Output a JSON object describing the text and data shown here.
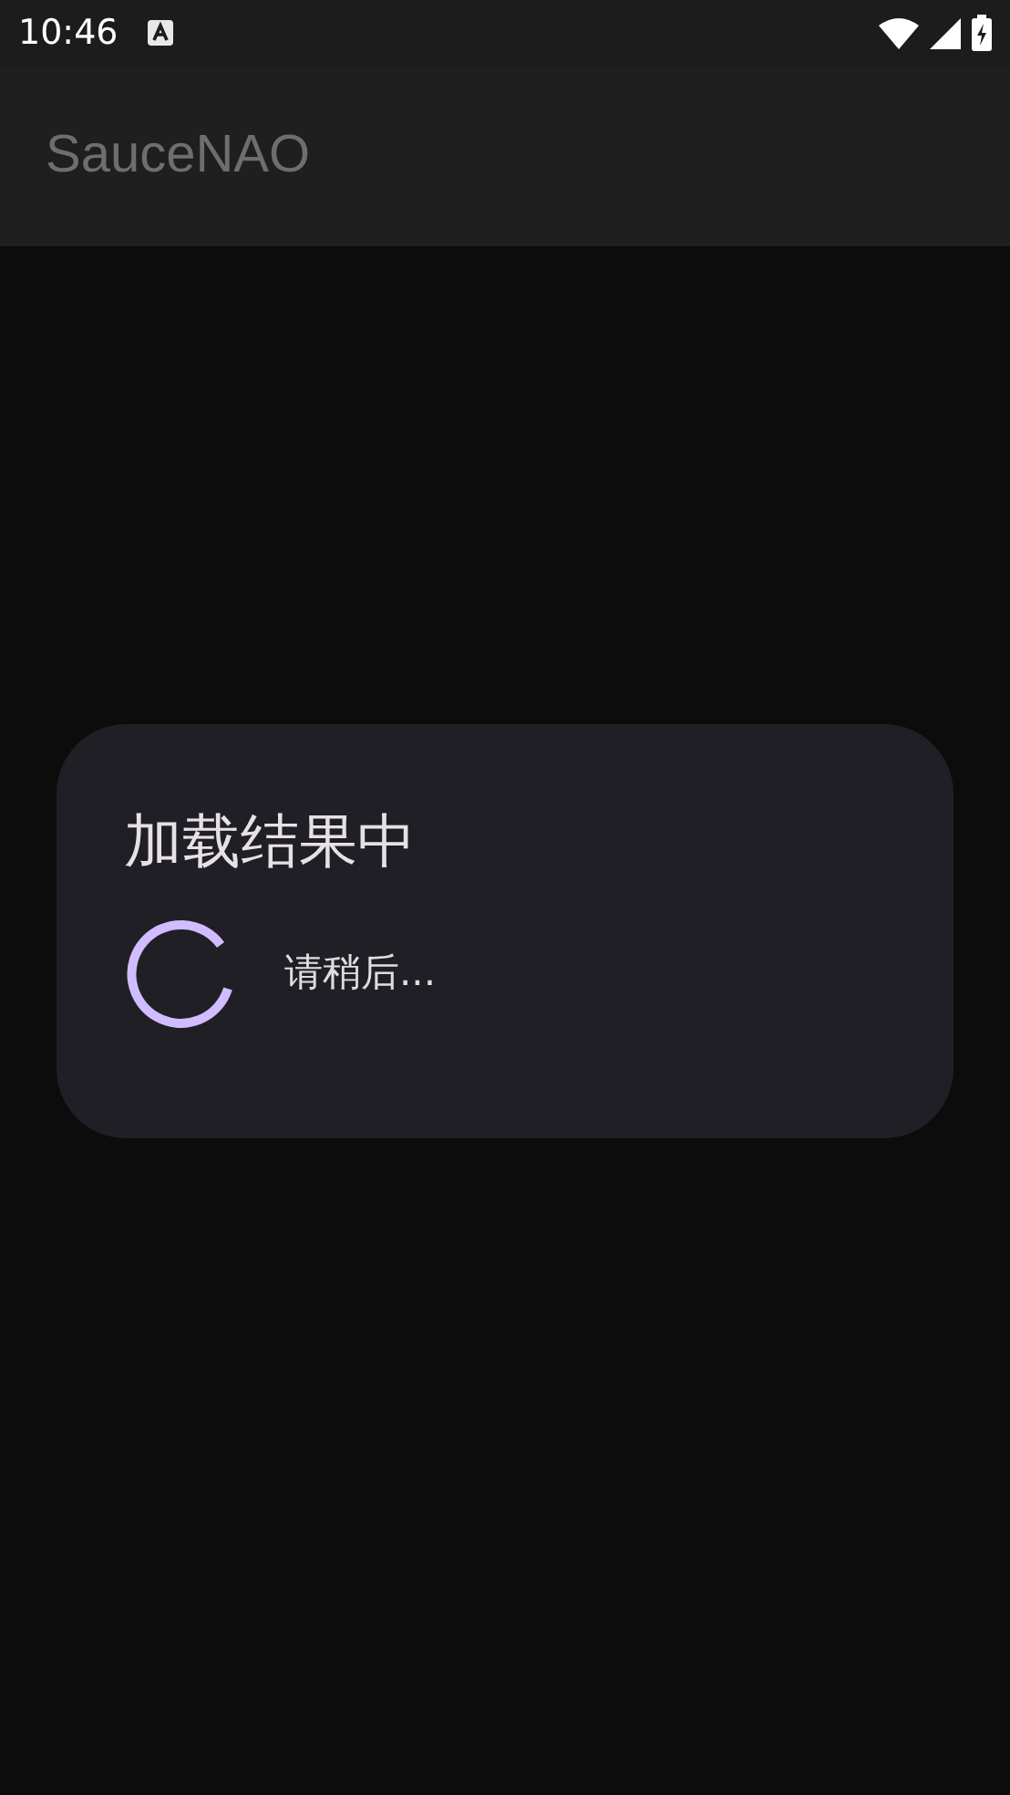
{
  "status_bar": {
    "time": "10:46"
  },
  "app_bar": {
    "title": "SauceNAO"
  },
  "dialog": {
    "title": "加载结果中",
    "message": "请稍后..."
  }
}
